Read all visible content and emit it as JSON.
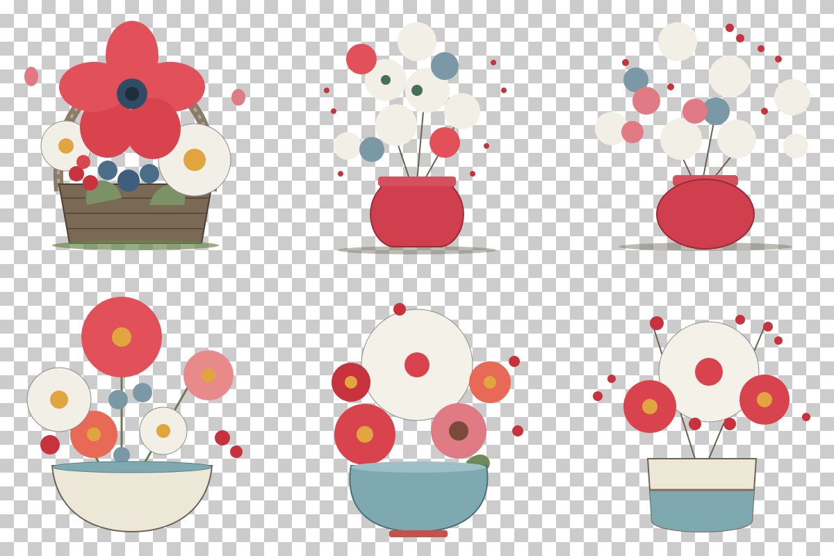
{
  "arrangements": [
    {
      "id": "basket",
      "container": "wicker-basket"
    },
    {
      "id": "red-vase-white-flowers",
      "container": "red-vase"
    },
    {
      "id": "red-round-vase-berries",
      "container": "red-round-vase"
    },
    {
      "id": "cream-bowl-daisies",
      "container": "cream-bowl"
    },
    {
      "id": "blue-bowl-daisy",
      "container": "blue-speckled-bowl"
    },
    {
      "id": "cream-blue-pot-daisy",
      "container": "cream-blue-pot"
    }
  ],
  "colors": {
    "red": "#e2505a",
    "deep_red": "#c7323c",
    "cream": "#f2efe6",
    "blue_grey": "#7b98a6",
    "teal": "#7fa9b0",
    "leaf": "#6e8a5a",
    "wicker": "#7a6a55",
    "checker": "#cccccc"
  }
}
